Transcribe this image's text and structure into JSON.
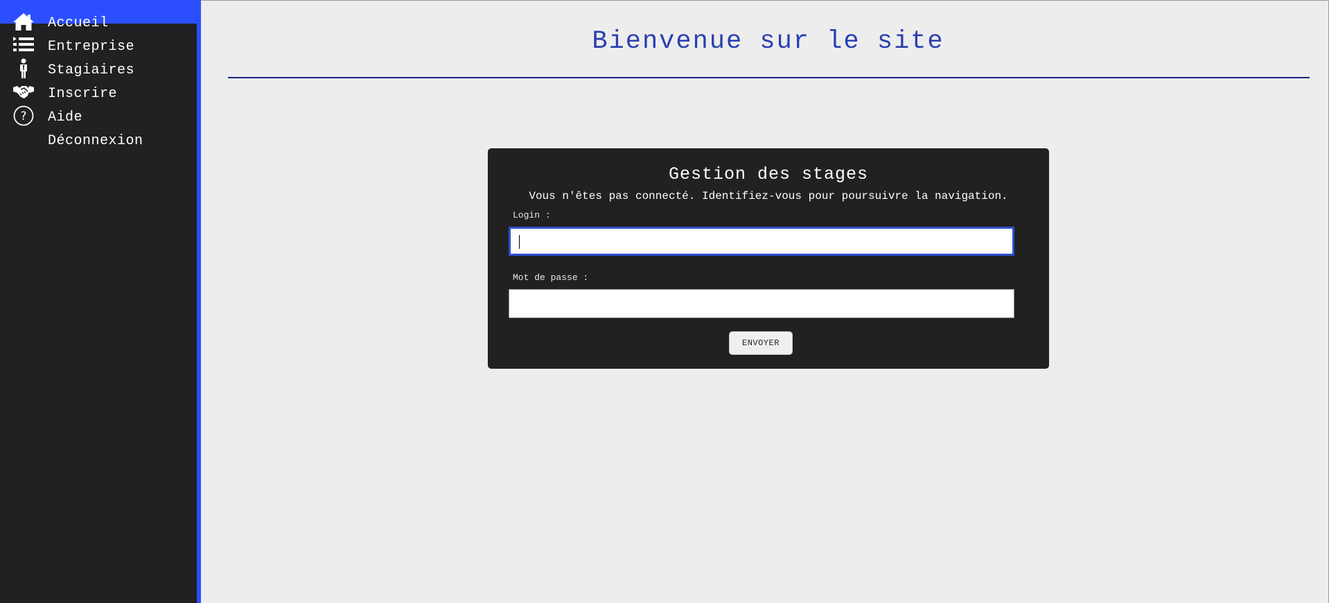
{
  "sidebar": {
    "items": [
      {
        "label": "Accueil",
        "icon": "home-icon"
      },
      {
        "label": "Entreprise",
        "icon": "list-icon"
      },
      {
        "label": "Stagiaires",
        "icon": "person-icon"
      },
      {
        "label": "Inscrire",
        "icon": "handshake-icon"
      },
      {
        "label": "Aide",
        "icon": "help-icon"
      },
      {
        "label": "Déconnexion",
        "icon": ""
      }
    ],
    "accent_color": "#2b4fff",
    "background_color": "#212121"
  },
  "header": {
    "title": "Bienvenue sur le site",
    "title_color": "#2a3fb0"
  },
  "login": {
    "title": "Gestion des stages",
    "subtitle": "Vous n'êtes pas connecté. Identifiez-vous pour poursuivre la navigation.",
    "login_label": "Login :",
    "login_value": "",
    "password_label": "Mot de passe :",
    "password_value": "",
    "submit_label": "ENVOYER"
  }
}
